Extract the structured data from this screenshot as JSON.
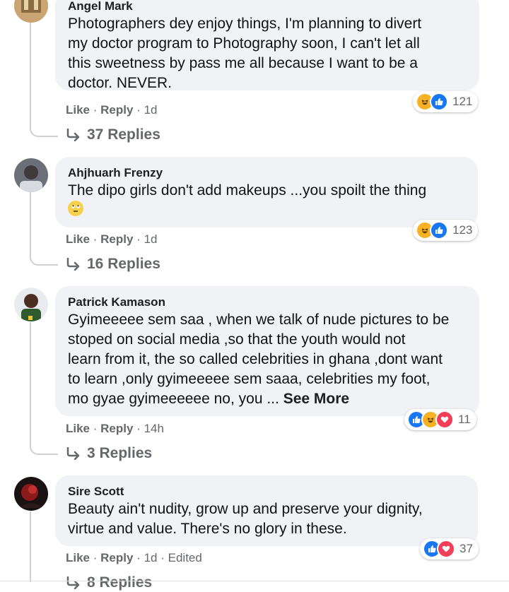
{
  "comments": [
    {
      "author": "Angel Mark",
      "text": "Photographers dey enjoy things, I'm planning to divert\nmy doctor program to Photography soon, I can't let all\nthis sweetness by pass me all because I want to be a\ndoctor. NEVER.",
      "like": "Like",
      "reply": "Reply",
      "time": "1d",
      "reaction_count": "121",
      "reactions": [
        "haha-icon",
        "like-icon"
      ],
      "replies_label": "37 Replies"
    },
    {
      "author": "Ahjhuarh Frenzy",
      "text": "The dipo girls don't add makeups ...you spoilt the thing",
      "emoji": "rolling-eyes-emoji",
      "like": "Like",
      "reply": "Reply",
      "time": "1d",
      "reaction_count": "123",
      "reactions": [
        "haha-icon",
        "like-icon"
      ],
      "replies_label": "16 Replies"
    },
    {
      "author": "Patrick Kamason",
      "text": "Gyimeeeee sem saa , when we talk of nude pictures to be\nstoped on social media ,so that the youth would not\nlearn from it, the so called celebrities in ghana ,dont want\nto learn ,only gyimeeeee sem saaa, celebrities my foot,\nmo gyae gyimeeeeee no, you ...",
      "see_more": "See More",
      "like": "Like",
      "reply": "Reply",
      "time": "14h",
      "reaction_count": "11",
      "reactions": [
        "like-icon",
        "haha-icon",
        "love-icon"
      ],
      "replies_label": "3 Replies"
    },
    {
      "author": "Sire Scott",
      "text": "Beauty ain't nudity, grow up and preserve your dignity,\nvirtue and value. There's no glory in these.",
      "like": "Like",
      "reply": "Reply",
      "time": "1d",
      "edited": "Edited",
      "reaction_count": "37",
      "reactions": [
        "like-icon",
        "love-icon"
      ],
      "replies_label": "8 Replies"
    }
  ],
  "colors": {
    "bubble": "#f0f2f5",
    "meta_text": "#65676b",
    "like_blue": "#1877f2",
    "haha_yellow": "#f7b125",
    "love_red": "#f33e58"
  }
}
